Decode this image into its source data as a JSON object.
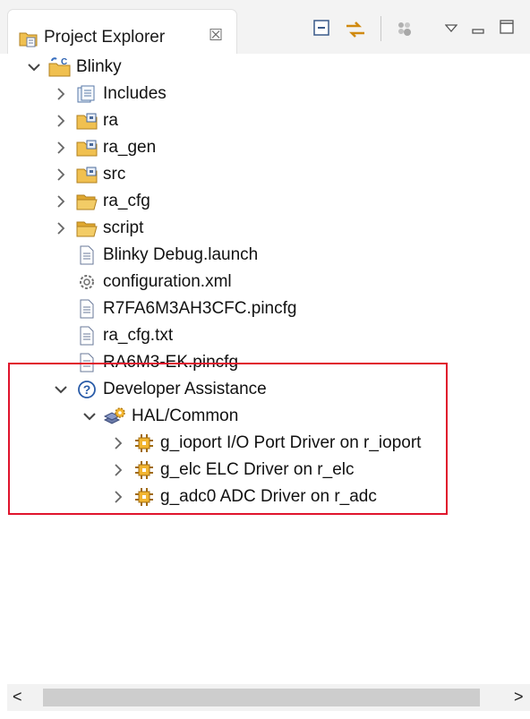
{
  "view": {
    "title": "Project Explorer",
    "close_glyph": "☒",
    "toolbar": [
      "collapse-all-icon",
      "link-with-editor-icon",
      "filter-icon",
      "view-menu-icon",
      "minimize-icon",
      "maximize-icon"
    ]
  },
  "tree": {
    "root": "Blinky",
    "children": [
      {
        "label": "Includes",
        "icon": "includes-icon"
      },
      {
        "label": "ra",
        "icon": "source-folder-icon"
      },
      {
        "label": "ra_gen",
        "icon": "source-folder-icon"
      },
      {
        "label": "src",
        "icon": "source-folder-icon"
      },
      {
        "label": "ra_cfg",
        "icon": "folder-icon"
      },
      {
        "label": "script",
        "icon": "folder-icon"
      },
      {
        "label": "Blinky Debug.launch",
        "icon": "file-icon"
      },
      {
        "label": "configuration.xml",
        "icon": "gear-file-icon"
      },
      {
        "label": "R7FA6M3AH3CFC.pincfg",
        "icon": "file-icon"
      },
      {
        "label": "ra_cfg.txt",
        "icon": "file-icon"
      },
      {
        "label": "RA6M3-EK.pincfg",
        "icon": "file-icon"
      }
    ],
    "developer_assistance": {
      "label": "Developer Assistance",
      "group": "HAL/Common",
      "drivers": [
        "g_ioport I/O Port Driver on r_ioport",
        "g_elc ELC Driver on r_elc",
        "g_adc0 ADC Driver on r_adc"
      ]
    }
  },
  "colors": {
    "highlight": "#e0142c",
    "folder": "#f0c050",
    "gear": "#e0a020"
  }
}
